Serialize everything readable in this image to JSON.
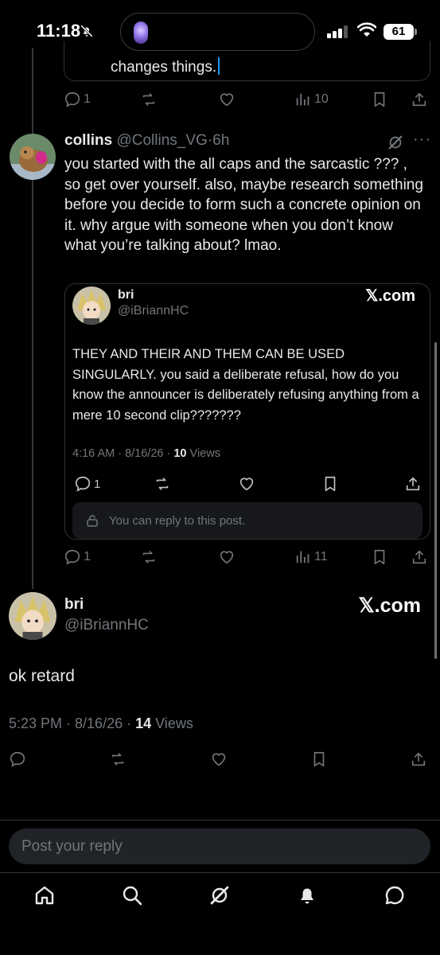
{
  "status_bar": {
    "time": "11:18",
    "battery": "61"
  },
  "top_card": {
    "text": "changes things."
  },
  "top_actions": {
    "replies": "1",
    "views": "10"
  },
  "reply_tweet": {
    "name": "collins",
    "handle": "@Collins_VG",
    "separator": "·",
    "age": "6h",
    "text": "you started with the all caps and the sarcastic ??? , so get over yourself. also, maybe research something before you decide to form such a concrete opinion on it. why argue with someone when you don’t know what you’re talking about? lmao.",
    "replies": "1",
    "views": "11"
  },
  "quote_card": {
    "name": "bri",
    "handle": "@iBriannHC",
    "brand": "𝕏.com",
    "text": "THEY AND THEIR AND THEM CAN BE USED SINGULARLY. you said a deliberate refusal, how do you know the announcer is deliberately refusing anything from a mere 10 second clip???????",
    "meta_prefix": "4:16 AM · 8/16/26 · ",
    "views_count": "10",
    "views_label": " Views",
    "replies": "1",
    "reply_notice": "You can reply to this post."
  },
  "main_tweet": {
    "name": "bri",
    "handle": "@iBriannHC",
    "brand": "𝕏.com",
    "text": "ok retard",
    "meta_prefix": "5:23 PM · 8/16/26 · ",
    "views_count": "14",
    "views_label": " Views"
  },
  "reply_box": {
    "placeholder": "Post your reply"
  },
  "colors": {
    "background": "#000000",
    "text": "#e7e9ea",
    "muted": "#71767b",
    "border": "#2f3336",
    "accent": "#1d9bf0"
  },
  "icons": [
    "home-icon",
    "search-icon",
    "grok-icon",
    "notifications-icon",
    "messages-icon"
  ]
}
